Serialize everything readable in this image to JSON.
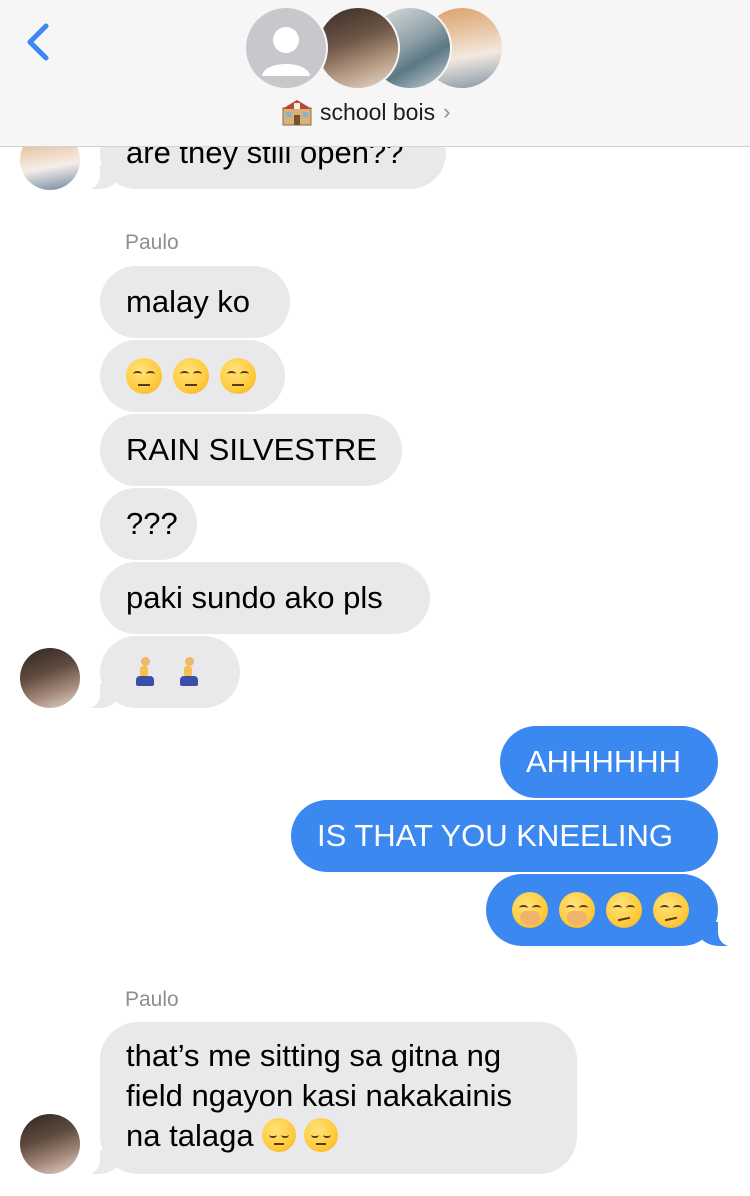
{
  "header": {
    "back_icon": "chevron-left-icon",
    "group_name": "school bois",
    "group_icon": "school-icon",
    "chevron_icon": "chevron-right-icon",
    "chevron": "›",
    "accent_color": "#3b88f1"
  },
  "messages": [
    {
      "text": "are they still open??"
    },
    {
      "sender": "Paulo"
    },
    {
      "text": "malay ko"
    },
    {
      "emoji": "unamused-face x3"
    },
    {
      "text": "RAIN SILVESTRE"
    },
    {
      "text": "???"
    },
    {
      "text": "paki sundo ako pls"
    },
    {
      "emoji": "person-kneeling x2"
    },
    {
      "text": "AHHHHHH"
    },
    {
      "text": "IS THAT YOU KNEELING"
    },
    {
      "emoji": "hand-over-mouth x2, smirking-face x2"
    },
    {
      "sender": "Paulo"
    },
    {
      "text": "that’s me sitting sa gitna ng field ngayon kasi nakakainis na talaga",
      "trailing_emoji": "pensive-face x2"
    }
  ]
}
